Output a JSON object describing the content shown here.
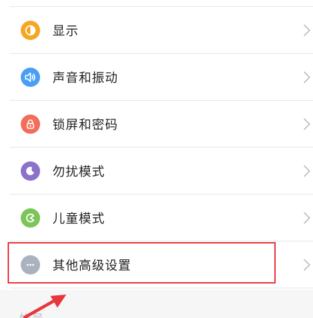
{
  "settings": {
    "items": [
      {
        "label": "显示",
        "icon": "display-icon",
        "color": "#F5A623"
      },
      {
        "label": "声音和振动",
        "icon": "speaker-icon",
        "color": "#4A9FF5"
      },
      {
        "label": "锁屏和密码",
        "icon": "lock-icon",
        "color": "#F26E5B"
      },
      {
        "label": "勿扰模式",
        "icon": "moon-icon",
        "color": "#8B73C9"
      },
      {
        "label": "儿童模式",
        "icon": "child-mode-icon",
        "color": "#7DC45A"
      },
      {
        "label": "其他高级设置",
        "icon": "more-icon",
        "color": "#AAB2BF"
      }
    ],
    "section_peek": "帐号"
  },
  "annotation": {
    "highlight_color": "#E8363A",
    "highlighted_item": "其他高级设置"
  }
}
